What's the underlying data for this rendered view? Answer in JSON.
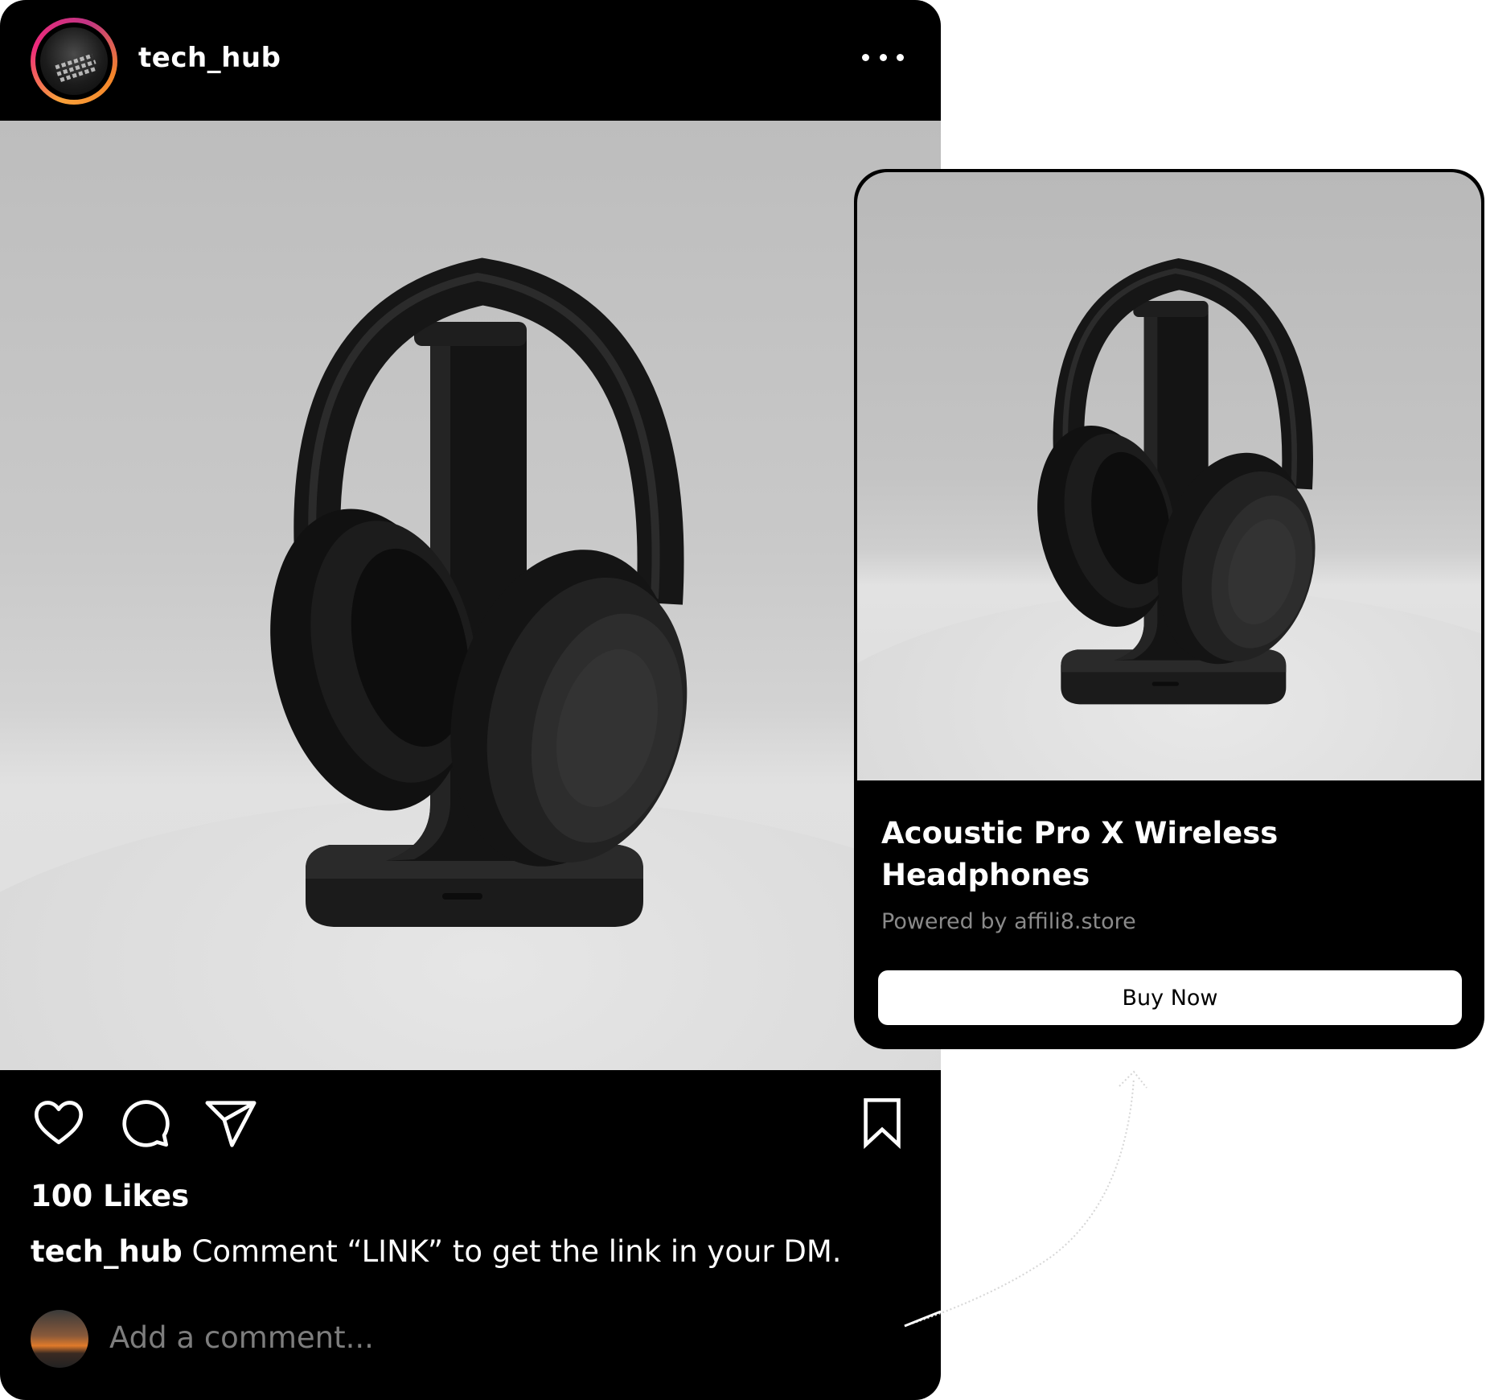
{
  "post": {
    "username": "tech_hub",
    "photo_alt": "headphones-on-stand",
    "likes": "100 Likes",
    "caption": {
      "user": "tech_hub",
      "text": "Comment “LINK” to get the link in your DM."
    },
    "comment_placeholder": "Add a comment..."
  },
  "product": {
    "title": "Acoustic Pro X Wireless Headphones",
    "powered_by": "Powered by affili8.store",
    "buy_label": "Buy Now"
  },
  "icons": {
    "more": "more-options-icon",
    "like": "heart-icon",
    "comment": "comment-icon",
    "share": "send-icon",
    "save": "bookmark-icon"
  },
  "colors": {
    "post_bg": "#000000",
    "text": "#ffffff",
    "muted": "#8a8a8a",
    "story_ring_start": "#f9a13a",
    "story_ring_end": "#ee2a7b",
    "button_bg": "#ffffff"
  }
}
